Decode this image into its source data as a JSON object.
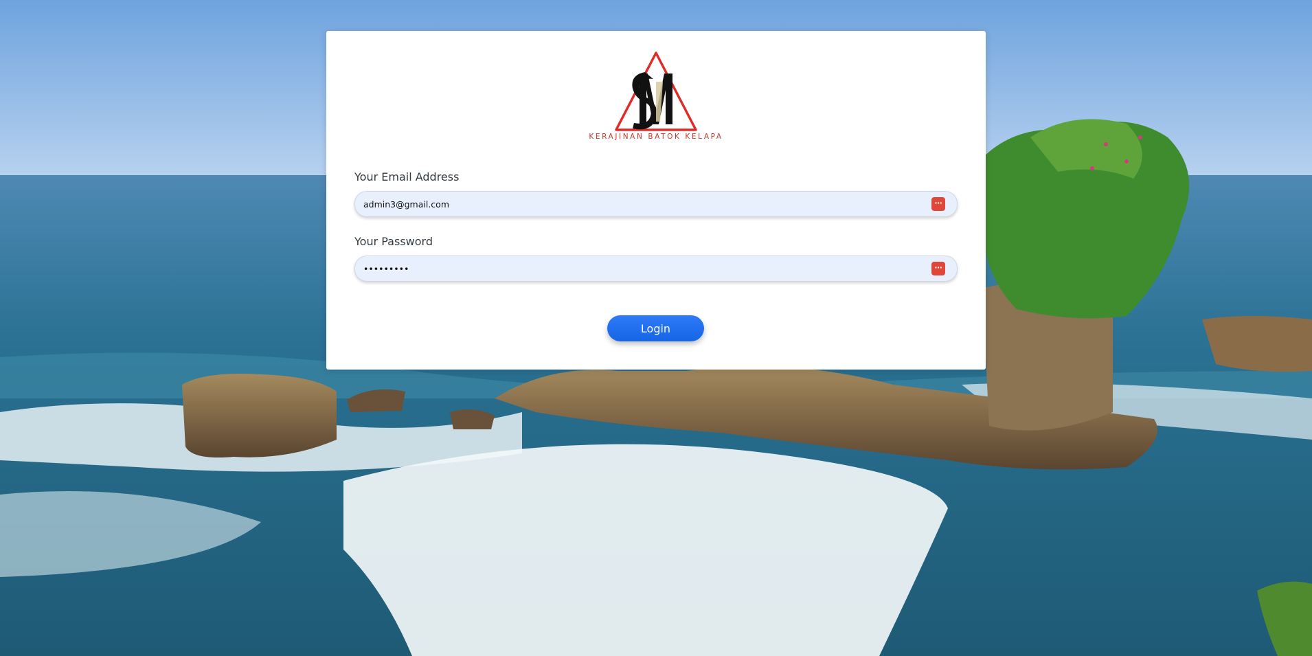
{
  "logo": {
    "monogram": "SM",
    "tagline": "KERAJINAN BATOK KELAPA"
  },
  "form": {
    "email": {
      "label": "Your Email Address",
      "value": "admin3@gmail.com",
      "placeholder": ""
    },
    "password": {
      "label": "Your Password",
      "value": "•••••••••",
      "placeholder": ""
    },
    "login_label": "Login"
  },
  "icons": {
    "email_field_icon": "password-manager-icon",
    "password_field_icon": "password-manager-icon"
  },
  "colors": {
    "primary": "#1a6ef0",
    "logo_red": "#e02b2b",
    "field_bg": "#e8f0fe",
    "icon_red": "#e0473b"
  }
}
